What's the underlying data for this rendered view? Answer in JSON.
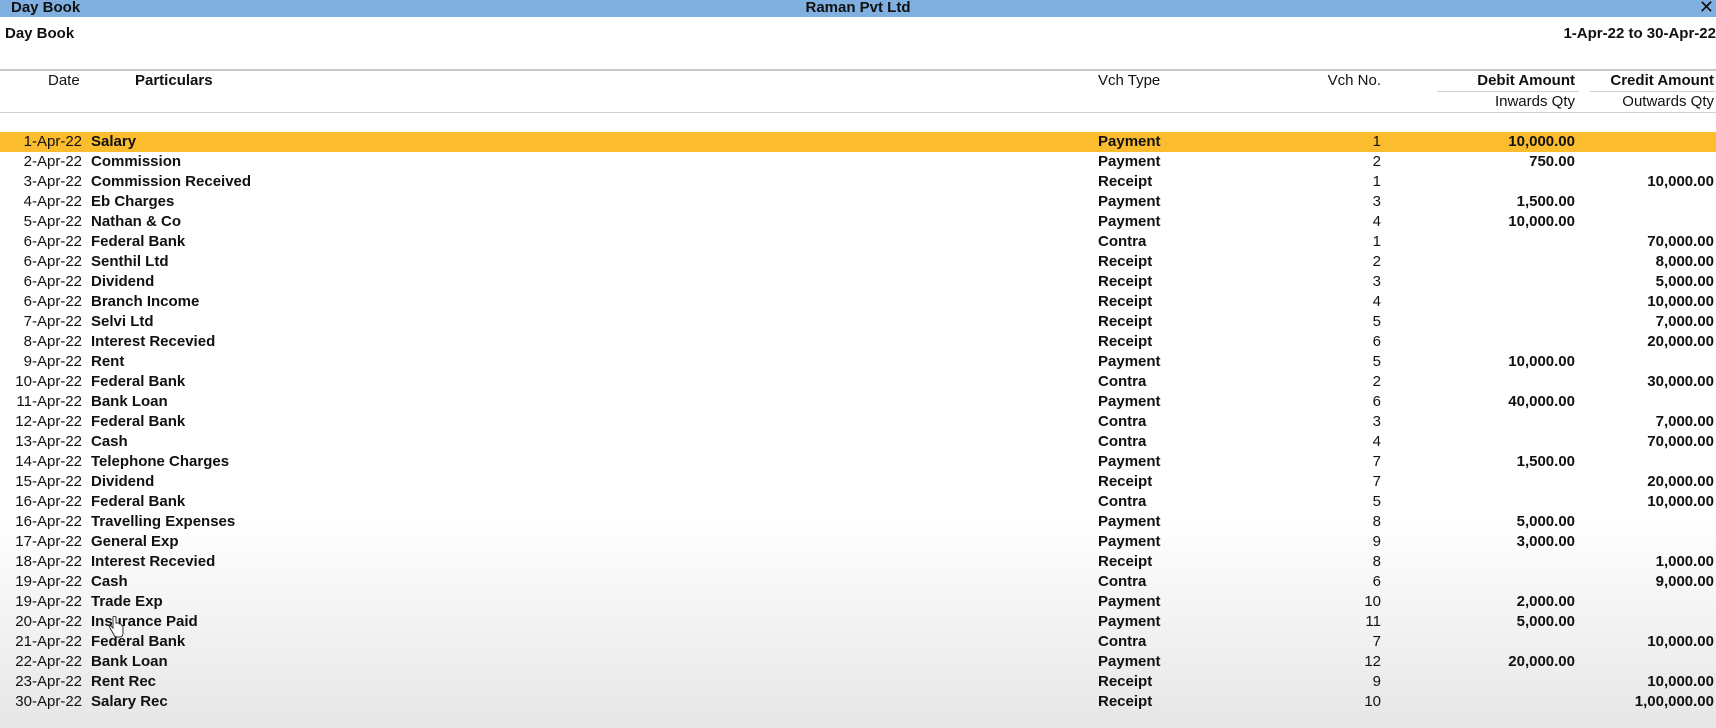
{
  "window": {
    "title": "Day Book",
    "company": "Raman Pvt Ltd",
    "close_icon": "close-icon"
  },
  "report": {
    "title": "Day Book",
    "period": "1-Apr-22 to 30-Apr-22"
  },
  "columns": {
    "date": "Date",
    "particulars": "Particulars",
    "vch_type": "Vch Type",
    "vch_no": "Vch No.",
    "debit": "Debit Amount",
    "debit_sub": "Inwards Qty",
    "credit": "Credit Amount",
    "credit_sub": "Outwards Qty"
  },
  "colors": {
    "titlebar": "#7fb0e0",
    "selected_row": "#fbbd2d"
  },
  "selected_index": 0,
  "rows": [
    {
      "date": "1-Apr-22",
      "particulars": "Salary",
      "vch_type": "Payment",
      "vch_no": "1",
      "debit": "10,000.00",
      "credit": ""
    },
    {
      "date": "2-Apr-22",
      "particulars": "Commission",
      "vch_type": "Payment",
      "vch_no": "2",
      "debit": "750.00",
      "credit": ""
    },
    {
      "date": "3-Apr-22",
      "particulars": "Commission Received",
      "vch_type": "Receipt",
      "vch_no": "1",
      "debit": "",
      "credit": "10,000.00"
    },
    {
      "date": "4-Apr-22",
      "particulars": "Eb Charges",
      "vch_type": "Payment",
      "vch_no": "3",
      "debit": "1,500.00",
      "credit": ""
    },
    {
      "date": "5-Apr-22",
      "particulars": "Nathan & Co",
      "vch_type": "Payment",
      "vch_no": "4",
      "debit": "10,000.00",
      "credit": ""
    },
    {
      "date": "6-Apr-22",
      "particulars": "Federal Bank",
      "vch_type": "Contra",
      "vch_no": "1",
      "debit": "",
      "credit": "70,000.00"
    },
    {
      "date": "6-Apr-22",
      "particulars": "Senthil Ltd",
      "vch_type": "Receipt",
      "vch_no": "2",
      "debit": "",
      "credit": "8,000.00"
    },
    {
      "date": "6-Apr-22",
      "particulars": "Dividend",
      "vch_type": "Receipt",
      "vch_no": "3",
      "debit": "",
      "credit": "5,000.00"
    },
    {
      "date": "6-Apr-22",
      "particulars": "Branch Income",
      "vch_type": "Receipt",
      "vch_no": "4",
      "debit": "",
      "credit": "10,000.00"
    },
    {
      "date": "7-Apr-22",
      "particulars": "Selvi Ltd",
      "vch_type": "Receipt",
      "vch_no": "5",
      "debit": "",
      "credit": "7,000.00"
    },
    {
      "date": "8-Apr-22",
      "particulars": "Interest Recevied",
      "vch_type": "Receipt",
      "vch_no": "6",
      "debit": "",
      "credit": "20,000.00"
    },
    {
      "date": "9-Apr-22",
      "particulars": "Rent",
      "vch_type": "Payment",
      "vch_no": "5",
      "debit": "10,000.00",
      "credit": ""
    },
    {
      "date": "10-Apr-22",
      "particulars": "Federal Bank",
      "vch_type": "Contra",
      "vch_no": "2",
      "debit": "",
      "credit": "30,000.00"
    },
    {
      "date": "11-Apr-22",
      "particulars": "Bank Loan",
      "vch_type": "Payment",
      "vch_no": "6",
      "debit": "40,000.00",
      "credit": ""
    },
    {
      "date": "12-Apr-22",
      "particulars": "Federal Bank",
      "vch_type": "Contra",
      "vch_no": "3",
      "debit": "",
      "credit": "7,000.00"
    },
    {
      "date": "13-Apr-22",
      "particulars": "Cash",
      "vch_type": "Contra",
      "vch_no": "4",
      "debit": "",
      "credit": "70,000.00"
    },
    {
      "date": "14-Apr-22",
      "particulars": "Telephone Charges",
      "vch_type": "Payment",
      "vch_no": "7",
      "debit": "1,500.00",
      "credit": ""
    },
    {
      "date": "15-Apr-22",
      "particulars": "Dividend",
      "vch_type": "Receipt",
      "vch_no": "7",
      "debit": "",
      "credit": "20,000.00"
    },
    {
      "date": "16-Apr-22",
      "particulars": "Federal Bank",
      "vch_type": "Contra",
      "vch_no": "5",
      "debit": "",
      "credit": "10,000.00"
    },
    {
      "date": "16-Apr-22",
      "particulars": "Travelling Expenses",
      "vch_type": "Payment",
      "vch_no": "8",
      "debit": "5,000.00",
      "credit": ""
    },
    {
      "date": "17-Apr-22",
      "particulars": "General Exp",
      "vch_type": "Payment",
      "vch_no": "9",
      "debit": "3,000.00",
      "credit": ""
    },
    {
      "date": "18-Apr-22",
      "particulars": "Interest Recevied",
      "vch_type": "Receipt",
      "vch_no": "8",
      "debit": "",
      "credit": "1,000.00"
    },
    {
      "date": "19-Apr-22",
      "particulars": "Cash",
      "vch_type": "Contra",
      "vch_no": "6",
      "debit": "",
      "credit": "9,000.00"
    },
    {
      "date": "19-Apr-22",
      "particulars": "Trade Exp",
      "vch_type": "Payment",
      "vch_no": "10",
      "debit": "2,000.00",
      "credit": ""
    },
    {
      "date": "20-Apr-22",
      "particulars": "Insurance Paid",
      "vch_type": "Payment",
      "vch_no": "11",
      "debit": "5,000.00",
      "credit": ""
    },
    {
      "date": "21-Apr-22",
      "particulars": "Federal Bank",
      "vch_type": "Contra",
      "vch_no": "7",
      "debit": "",
      "credit": "10,000.00"
    },
    {
      "date": "22-Apr-22",
      "particulars": "Bank Loan",
      "vch_type": "Payment",
      "vch_no": "12",
      "debit": "20,000.00",
      "credit": ""
    },
    {
      "date": "23-Apr-22",
      "particulars": "Rent Rec",
      "vch_type": "Receipt",
      "vch_no": "9",
      "debit": "",
      "credit": "10,000.00"
    },
    {
      "date": "30-Apr-22",
      "particulars": "Salary Rec",
      "vch_type": "Receipt",
      "vch_no": "10",
      "debit": "",
      "credit": "1,00,000.00"
    }
  ]
}
